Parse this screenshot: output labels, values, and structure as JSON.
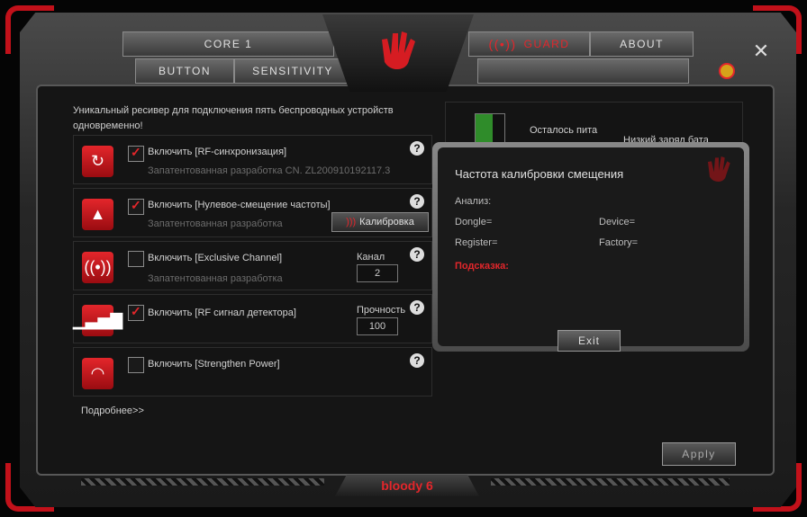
{
  "tabs": {
    "core": "Core 1",
    "button": "Button",
    "sensitivity": "Sensitivity",
    "guard": "Guard",
    "about": "About"
  },
  "intro": "Уникальный ресивер для подключения пять беспроводных устройств одновременно!",
  "features": [
    {
      "label": "Включить [RF-синхронизация]",
      "sub": "Запатентованная разработка CN. ZL200910192117.3",
      "checked": true
    },
    {
      "label": "Включить [Нулевое-смещение частоты]",
      "sub": "Запатентованная разработка",
      "checked": true,
      "button": "Калибровка"
    },
    {
      "label": "Включить [Exclusive Channel]",
      "sub": "Запатентованная разработка",
      "checked": false,
      "field_label": "Канал",
      "field_value": "2"
    },
    {
      "label": "Включить [RF сигнал детектора]",
      "checked": true,
      "field_label": "Прочность",
      "field_value": "100"
    },
    {
      "label": "Включить [Strengthen Power]",
      "checked": false
    }
  ],
  "help_glyph": "?",
  "more_link": "Подробнее>>",
  "battery": {
    "remaining": "Осталось пита",
    "low": "Низкий заряд бата"
  },
  "dialog": {
    "title": "Частота калибровки смещения",
    "analysis": "Анализ:",
    "dongle": "Dongle=",
    "device": "Device=",
    "register": "Register=",
    "factory": "Factory=",
    "tip": "Подсказка:",
    "exit": "Exit"
  },
  "apply": "Apply",
  "footer": "bloody 6",
  "close": "✕",
  "colors": {
    "accent": "#e3262b",
    "panel": "#141414",
    "frame": "#3a3a3a"
  }
}
